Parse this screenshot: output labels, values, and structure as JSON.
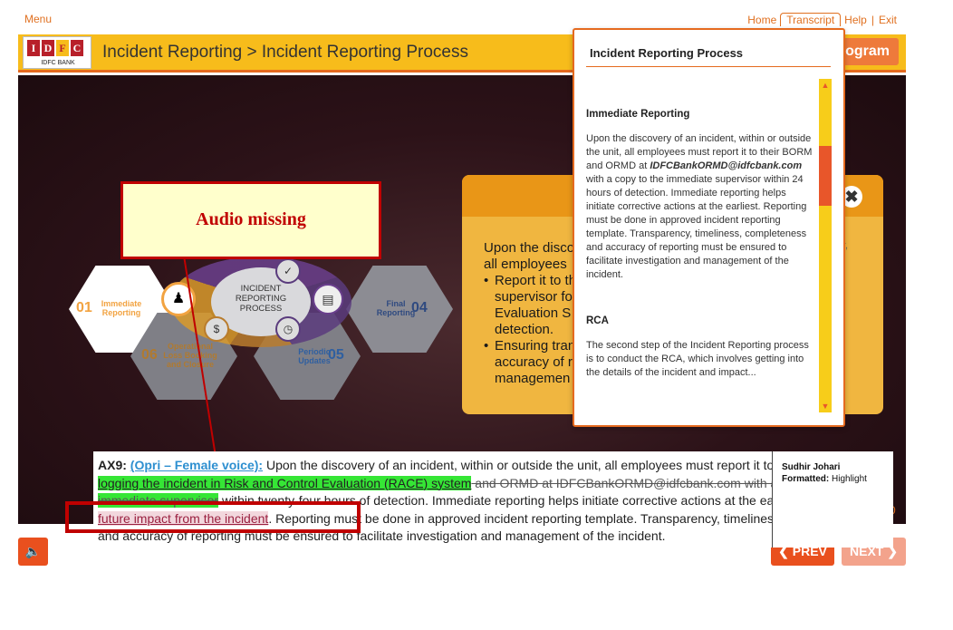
{
  "nav": {
    "menu": "Menu",
    "home": "Home",
    "transcript": "Transcript",
    "help": "Help",
    "exit": "Exit",
    "separator": "|"
  },
  "header": {
    "logo_letters": [
      "I",
      "D",
      "F",
      "C"
    ],
    "logo_subtitle": "IDFC BANK",
    "title": "Incident Reporting > Incident Reporting Process",
    "program_label": "rogram"
  },
  "diagram": {
    "center_label": "INCIDENT REPORTING PROCESS",
    "steps": [
      {
        "num": "01",
        "label": "Immediate Reporting"
      },
      {
        "num": "04",
        "label": "Final Reporting"
      },
      {
        "num": "05",
        "label": "Periodic Updates"
      },
      {
        "num": "06",
        "label": "Operational Loss Booking and Closure"
      }
    ]
  },
  "content_panel": {
    "intro": "Upon the disco all employees",
    "bullets": [
      "Report it to th supervisor fo Evaluation S detection.",
      "Ensuring tran accuracy of r managemen"
    ],
    "side_fragment": "r,",
    "close_icon": "close-icon"
  },
  "annotation": {
    "audio_missing": "Audio missing"
  },
  "transcript": {
    "title": "Incident Reporting Process",
    "sections": [
      {
        "heading": "Immediate Reporting",
        "text_before": "Upon the discovery of an incident, within or outside the unit, all employees must report it to their BORM and ORMD at ",
        "email": "IDFCBankORMD@idfcbank.com",
        "text_after": " with a copy to the immediate supervisor within 24 hours of detection. Immediate reporting helps initiate corrective actions at the earliest. Reporting must be done in approved incident reporting template. Transparency, timeliness, completeness and accuracy of reporting must be ensured to facilitate investigation and management of the incident."
      },
      {
        "heading": "RCA",
        "text": "The second step of the Incident Reporting process is to conduct the RCA, which involves getting into the details of the incident and impact..."
      }
    ]
  },
  "bottom": {
    "prev": "PREV",
    "next": "NEXT",
    "audio_icon": "speaker-icon",
    "page_fragment": "0"
  },
  "document": {
    "ax_label": "AX9:",
    "voice_label": "(Opri – Female voice):",
    "part1": " Upon the discovery of an incident, within or outside the unit, all employees must report it to their BORM ",
    "green1": "for logging the incident in Risk and Control Evaluation (RACE) system",
    "strike1": " and ORMD at IDFCBankORMD@idfcbank.com with a copy to",
    "green2": "the immediate supervisor",
    "part2": " within twenty-four hours of detection. Immediate reporting helps initiate corrective actions at the earliest ",
    "pink": "minimizing future impact from the incident",
    "part3": ". Reporting must be done in approved incident reporting template. Transparency, timeliness, completeness and accuracy of reporting must be ensured to facilitate investigation and management of the incident."
  },
  "comment": {
    "author": "Sudhir Johari",
    "format_label": "Formatted:",
    "format_value": " Highlight"
  },
  "colors": {
    "accent_orange": "#e56a1f",
    "header_yellow": "#f7bc1b",
    "annotation_red": "#c00000",
    "highlight_green": "#35e635"
  }
}
